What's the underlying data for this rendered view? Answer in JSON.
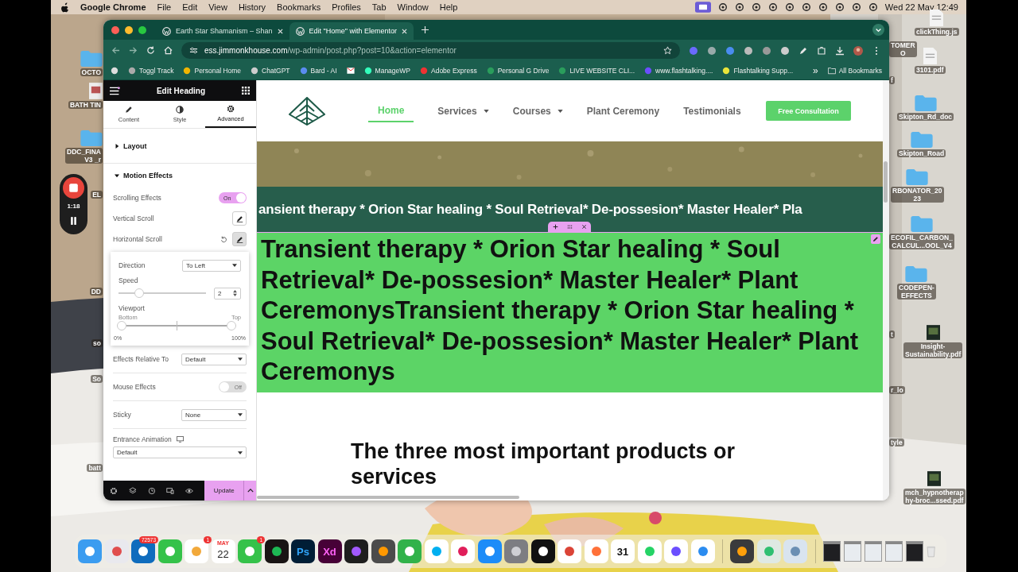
{
  "menu_bar": {
    "app": "Google Chrome",
    "menus": [
      "File",
      "Edit",
      "View",
      "History",
      "Bookmarks",
      "Profiles",
      "Tab",
      "Window",
      "Help"
    ],
    "clock": "Wed 22 May  12:49"
  },
  "desktop_left": [
    {
      "label": "OCTO",
      "kind": "folder"
    },
    {
      "label": "BATH TIN",
      "kind": "file"
    },
    {
      "label": "DDC_FINA\nV3 _r",
      "kind": "folder"
    },
    {
      "label": "EL",
      "kind": "none"
    },
    {
      "label": "DD",
      "kind": "none"
    },
    {
      "label": "so",
      "kind": "none"
    },
    {
      "label": "So",
      "kind": "none"
    },
    {
      "label": "batt",
      "kind": "none"
    }
  ],
  "desktop_right": [
    {
      "label": "TOMER\nO",
      "kind": "none"
    },
    {
      "label": "clickThing.js",
      "kind": "file"
    },
    {
      "label": "f",
      "kind": "none"
    },
    {
      "label": "3101.pdf",
      "kind": "file"
    },
    {
      "label": "Skipton_Rd_doc",
      "kind": "folder"
    },
    {
      "label": "Skipton_Road",
      "kind": "folder"
    },
    {
      "label": "RBONATOR_20\n23",
      "kind": "folder"
    },
    {
      "label": "ECOFIL_CARBON_\nCALCUL...OOL_V4",
      "kind": "folder"
    },
    {
      "label": "CODEPEN-\nEFFECTS",
      "kind": "folder"
    },
    {
      "label": "t",
      "kind": "none"
    },
    {
      "label": "Insight-\nSustainability.pdf",
      "kind": "thumb"
    },
    {
      "label": "r_lo",
      "kind": "none"
    },
    {
      "label": "tyle",
      "kind": "none"
    },
    {
      "label": "mch_hypnotherap\nhy-broc...ssed.pdf",
      "kind": "thumb"
    }
  ],
  "recorder": {
    "time": "1:18"
  },
  "browser": {
    "tabs": [
      {
        "title": "Earth Star Shamanism – Shan",
        "selected": false
      },
      {
        "title": "Edit \"Home\" with Elementor",
        "selected": true
      }
    ],
    "url_host": "ess.jimmonkhouse.com",
    "url_path": "/wp-admin/post.php?post=10&action=elementor",
    "bookmarks": [
      {
        "label": "Toggl Track"
      },
      {
        "label": "Personal Home"
      },
      {
        "label": "ChatGPT"
      },
      {
        "label": "Bard - AI"
      },
      {
        "kind": "icon"
      },
      {
        "label": "ManageWP"
      },
      {
        "label": "Adobe Express"
      },
      {
        "label": "Personal G Drive"
      },
      {
        "label": "LIVE WEBSITE CLI..."
      },
      {
        "label": "www.flashtalking...."
      },
      {
        "label": "Flashtalking Supp..."
      }
    ],
    "more_bookmarks": "»",
    "all_bookmarks": "All Bookmarks"
  },
  "editor_panel": {
    "title": "Edit Heading",
    "tabs": [
      {
        "label": "Content",
        "kind": "pencil",
        "selected": false
      },
      {
        "label": "Style",
        "kind": "contrast",
        "selected": false
      },
      {
        "label": "Advanced",
        "kind": "gear",
        "selected": true
      }
    ],
    "sections": [
      {
        "label": "Layout",
        "expanded": false
      },
      {
        "label": "Motion Effects",
        "expanded": true
      }
    ],
    "rows": [
      {
        "kind": "toggle",
        "label": "Scrolling Effects",
        "on": true,
        "state_text": "On"
      },
      {
        "kind": "edit",
        "label": "Vertical Scroll",
        "active": false
      },
      {
        "kind": "edit",
        "label": "Horizontal Scroll",
        "active": true
      }
    ],
    "popover": {
      "direction_label": "Direction",
      "direction": "To Left",
      "speed_label": "Speed",
      "speed": {
        "level": 0.2,
        "value": "2"
      },
      "viewport_label": "Viewport",
      "viewport": {
        "level": 1,
        "start_hint": "Bottom",
        "end_hint": "Top",
        "start": "0%",
        "end": "100%"
      }
    },
    "rows_after": [
      {
        "kind": "select",
        "label": "Effects Relative To",
        "value": "Default"
      },
      {
        "kind": "toggle",
        "label": "Mouse Effects",
        "on": false,
        "state_text": "Off"
      },
      {
        "kind": "select",
        "label": "Sticky",
        "value": "None"
      },
      {
        "kind": "responsive",
        "label": "Entrance Animation",
        "value": "Default"
      }
    ],
    "update": "Update"
  },
  "site": {
    "nav": [
      {
        "label": "Home",
        "selected": true,
        "dropdown": false
      },
      {
        "label": "Services",
        "selected": false,
        "dropdown": true
      },
      {
        "label": "Courses",
        "selected": false,
        "dropdown": true
      },
      {
        "label": "Plant Ceremony",
        "selected": false,
        "dropdown": false
      },
      {
        "label": "Testimonials",
        "selected": false,
        "dropdown": false
      }
    ],
    "cta": "Free Consultation",
    "marquee": "ansient therapy * Orion Star healing * Soul Retrieval* De-possesion* Master Healer* Pla",
    "heading": "Transient therapy * Orion Star healing * Soul Retrieval* De-possesion* Master Healer* Plant CeremonysTransient therapy * Orion Star healing * Soul Retrieval* De-possesion* Master Healer* Plant Ceremonys",
    "subheading": "The three most important products or services"
  },
  "dock": {
    "apps": [
      {
        "kind": "finder"
      },
      {
        "kind": "launchpad"
      },
      {
        "kind": "mail",
        "badge": "72573"
      },
      {
        "kind": "video"
      },
      {
        "kind": "photos",
        "badge": "1"
      },
      {
        "kind": "calendar",
        "text": "22",
        "month": "MAY"
      },
      {
        "kind": "messages",
        "badge": "1"
      },
      {
        "kind": "music"
      },
      {
        "kind": "ps",
        "text": "Ps"
      },
      {
        "kind": "xd",
        "text": "Xd"
      },
      {
        "kind": "figma"
      },
      {
        "kind": "sublime"
      },
      {
        "kind": "numbers"
      },
      {
        "kind": "skype"
      },
      {
        "kind": "slack"
      },
      {
        "kind": "store"
      },
      {
        "kind": "settings"
      },
      {
        "kind": "screenshot"
      },
      {
        "kind": "chrome"
      },
      {
        "kind": "firefox"
      },
      {
        "kind": "cal31",
        "text": "31"
      },
      {
        "kind": "whatsapp"
      },
      {
        "kind": "flower"
      },
      {
        "kind": "freeform"
      }
    ],
    "recent": [
      {
        "kind": "calculator"
      },
      {
        "kind": "findmy"
      },
      {
        "kind": "preview"
      }
    ],
    "windows": [
      {
        "kind": "dark"
      },
      {
        "kind": "light"
      },
      {
        "kind": "light"
      },
      {
        "kind": "light"
      },
      {
        "kind": "dark"
      }
    ]
  }
}
